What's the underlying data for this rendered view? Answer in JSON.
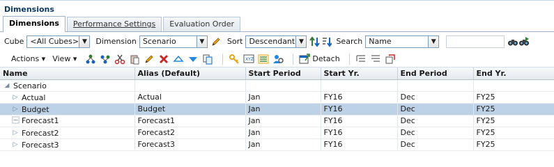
{
  "panel": {
    "title": "Dimensions"
  },
  "tabs": [
    {
      "label": "Dimensions",
      "active": true
    },
    {
      "label": "Performance Settings",
      "active": false
    },
    {
      "label": "Evaluation Order",
      "active": false
    }
  ],
  "filters": {
    "cube_label": "Cube",
    "cube_value": "<All Cubes>",
    "dimension_label": "Dimension",
    "dimension_value": "Scenario",
    "sort_label": "Sort",
    "sort_value": "Descendants",
    "search_label": "Search",
    "search_field_value": "Name",
    "search_text": ""
  },
  "toolbar": {
    "actions_label": "Actions",
    "view_label": "View",
    "detach_label": "Detach"
  },
  "grid": {
    "columns": [
      "Name",
      "Alias (Default)",
      "Start Period",
      "Start Yr.",
      "End Period",
      "End Yr."
    ],
    "root": {
      "name": "Scenario"
    },
    "rows": [
      {
        "name": "Actual",
        "alias": "Actual",
        "start_period": "Jan",
        "start_yr": "FY16",
        "end_period": "Dec",
        "end_yr": "FY25"
      },
      {
        "name": "Budget",
        "alias": "Budget",
        "start_period": "Jan",
        "start_yr": "FY16",
        "end_period": "Dec",
        "end_yr": "FY25"
      },
      {
        "name": "Forecast1",
        "alias": "Forecast1",
        "start_period": "Jan",
        "start_yr": "FY16",
        "end_period": "Dec",
        "end_yr": "FY25"
      },
      {
        "name": "Forecast2",
        "alias": "Forecast2",
        "start_period": "Jan",
        "start_yr": "FY16",
        "end_period": "Dec",
        "end_yr": "FY25"
      },
      {
        "name": "Forecast3",
        "alias": "Forecast3",
        "start_period": "Jan",
        "start_yr": "FY16",
        "end_period": "Dec",
        "end_yr": "FY25"
      }
    ]
  }
}
